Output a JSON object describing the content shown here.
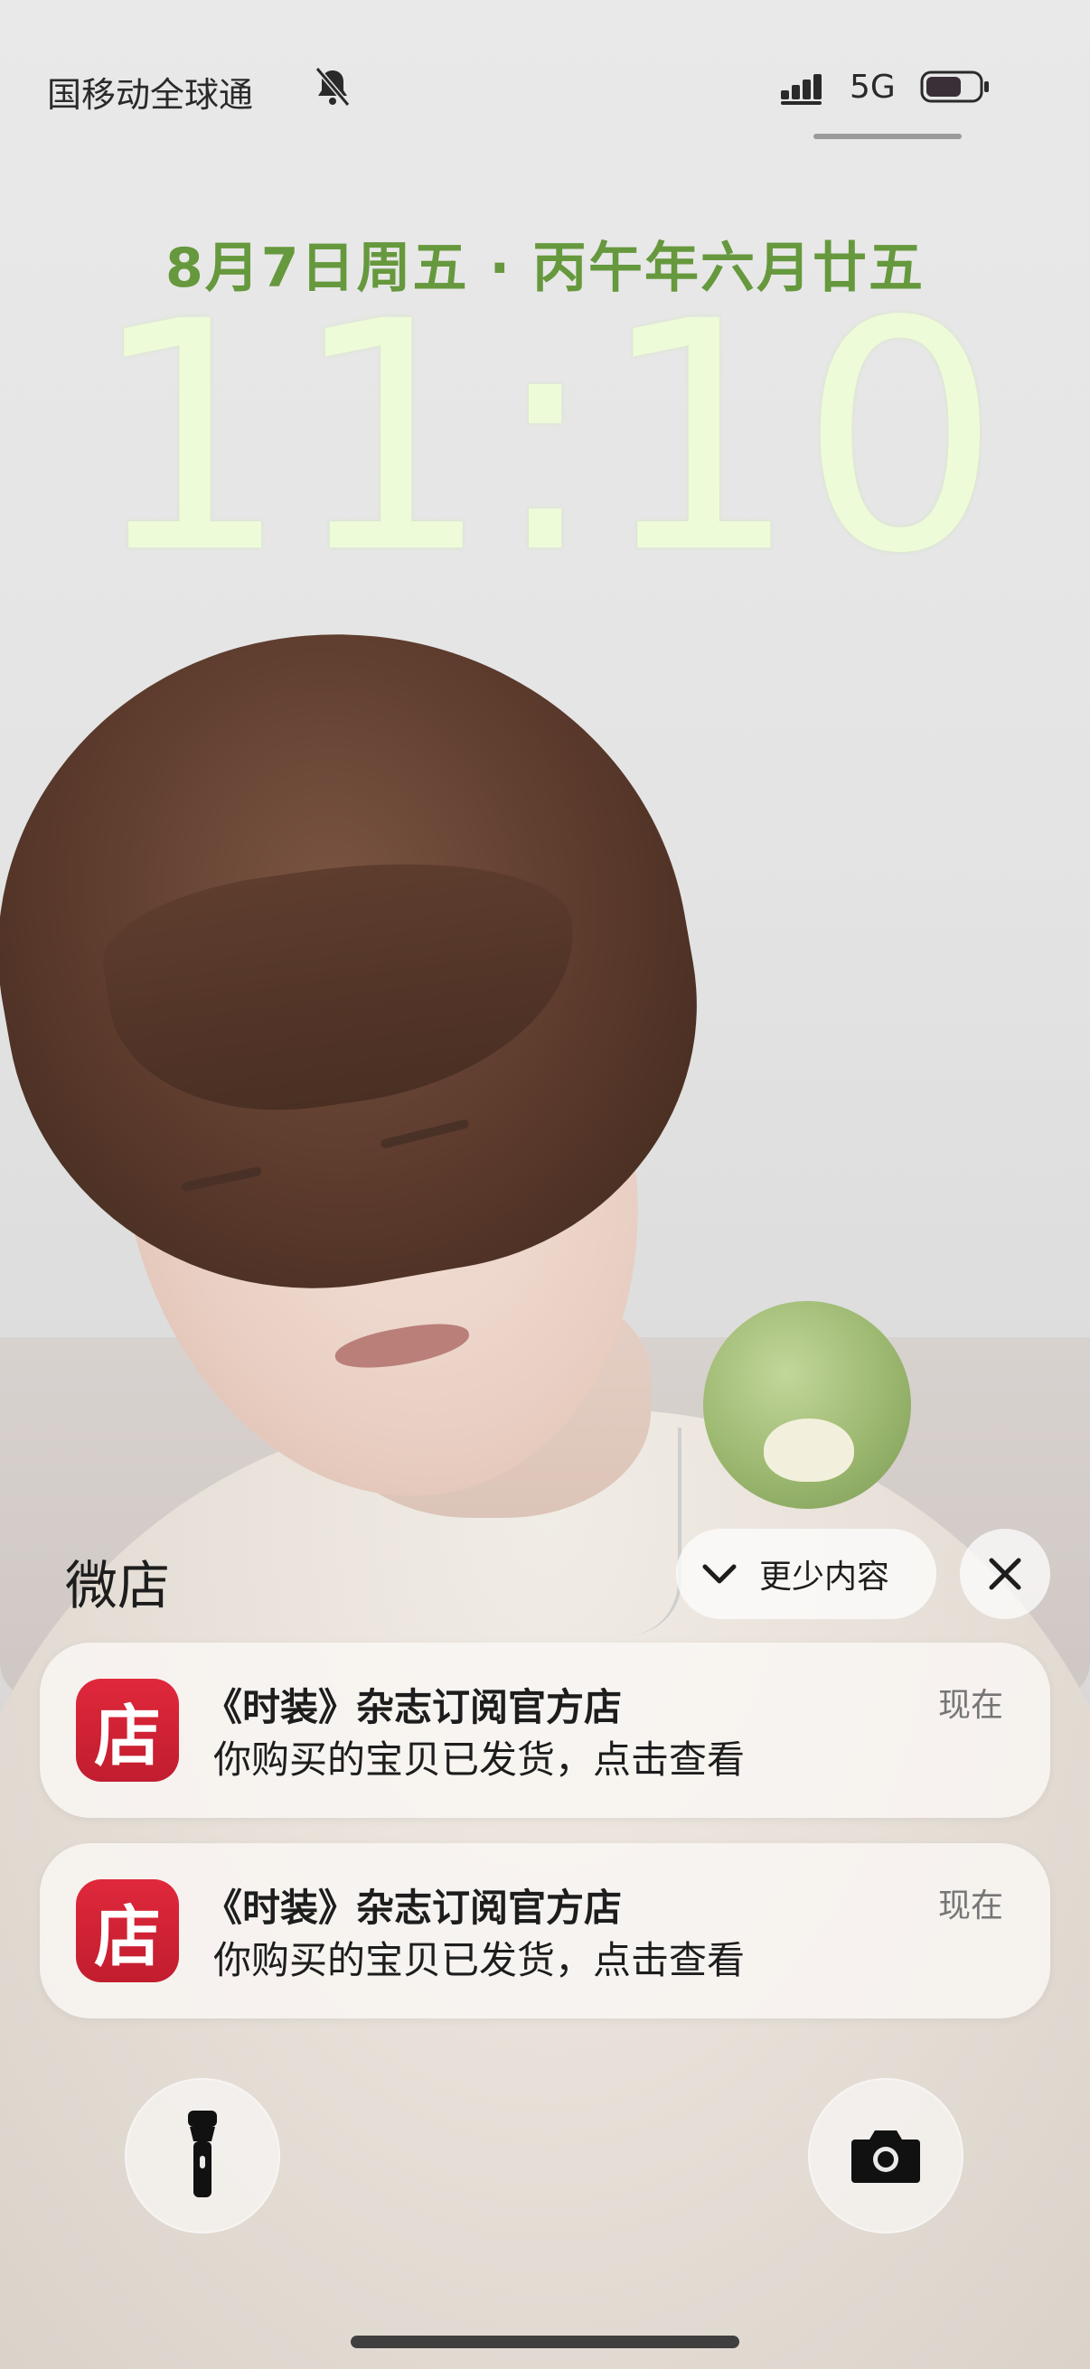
{
  "status_bar": {
    "carrier": "国移动全球通",
    "network": "5G",
    "icons": [
      "bell-muted-icon",
      "signal-icon",
      "battery-icon"
    ]
  },
  "lockscreen": {
    "date": "8月7日周五 · 丙午年六月廿五",
    "time": "11:10",
    "date_color": "#66983d",
    "time_color": "#eefbd9"
  },
  "notification_group": {
    "app_name": "微店",
    "collapse_label": "更少内容",
    "icons": [
      "chevron-down-icon",
      "close-icon"
    ]
  },
  "notifications": [
    {
      "app_icon_text": "店",
      "title": "《时装》杂志订阅官方店",
      "body": "你购买的宝贝已发货，点击查看",
      "time": "现在"
    },
    {
      "app_icon_text": "店",
      "title": "《时装》杂志订阅官方店",
      "body": "你购买的宝贝已发货，点击查看",
      "time": "现在"
    }
  ],
  "quick_actions": {
    "left": "flashlight-icon",
    "right": "camera-icon"
  },
  "colors": {
    "app_icon": "#d4243a"
  }
}
